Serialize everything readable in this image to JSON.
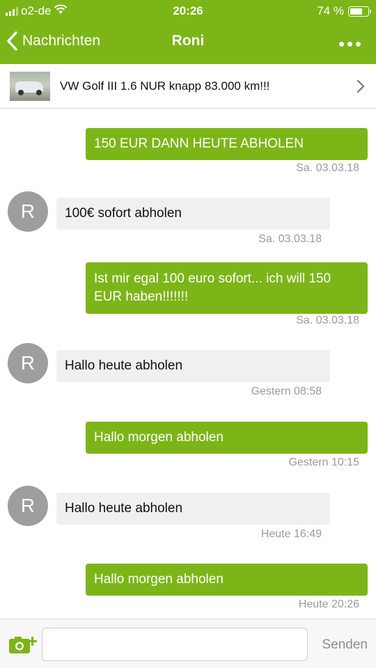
{
  "status": {
    "carrier": "o2-de",
    "time": "20:26",
    "battery": "74 %",
    "battery_level": 0.74
  },
  "nav": {
    "back_label": "Nachrichten",
    "title": "Roni"
  },
  "listing": {
    "title": "VW Golf III 1.6 NUR knapp 83.000 km!!!"
  },
  "contact": {
    "initial": "R"
  },
  "messages": [
    {
      "direction": "out",
      "text": "150 EUR DANN HEUTE ABHOLEN",
      "time": "Sa. 03.03.18"
    },
    {
      "direction": "in",
      "text": "100€ sofort abholen",
      "time": "Sa. 03.03.18"
    },
    {
      "direction": "out",
      "text": "Ist mir egal 100 euro sofort... ich will 150 EUR haben!!!!!!!",
      "time": "Sa. 03.03.18"
    },
    {
      "direction": "in",
      "text": "Hallo heute abholen",
      "time": "Gestern 08:58"
    },
    {
      "direction": "out",
      "text": "Hallo morgen abholen",
      "time": "Gestern 10:15"
    },
    {
      "direction": "in",
      "text": "Hallo heute abholen",
      "time": "Heute 16:49"
    },
    {
      "direction": "out",
      "text": "Hallo morgen abholen",
      "time": "Heute 20:26"
    }
  ],
  "composer": {
    "placeholder": "",
    "send_label": "Senden"
  },
  "colors": {
    "brand_green": "#7cb518",
    "incoming_bubble": "#f0f0f0",
    "avatar_gray": "#9e9e9e"
  }
}
